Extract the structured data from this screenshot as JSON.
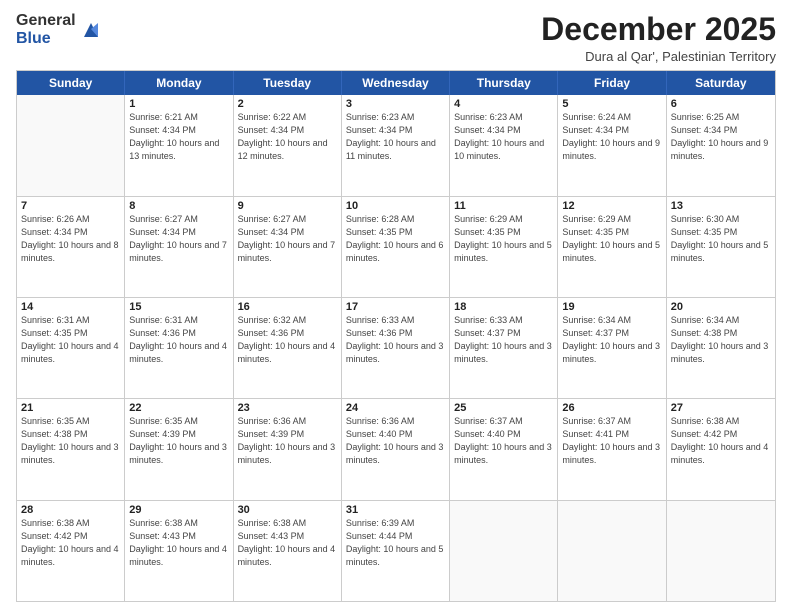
{
  "header": {
    "logo_general": "General",
    "logo_blue": "Blue",
    "month_title": "December 2025",
    "location": "Dura al Qar', Palestinian Territory"
  },
  "days_of_week": [
    "Sunday",
    "Monday",
    "Tuesday",
    "Wednesday",
    "Thursday",
    "Friday",
    "Saturday"
  ],
  "weeks": [
    [
      {
        "day": "",
        "empty": true
      },
      {
        "day": "1",
        "sunrise": "6:21 AM",
        "sunset": "4:34 PM",
        "daylight": "10 hours and 13 minutes."
      },
      {
        "day": "2",
        "sunrise": "6:22 AM",
        "sunset": "4:34 PM",
        "daylight": "10 hours and 12 minutes."
      },
      {
        "day": "3",
        "sunrise": "6:23 AM",
        "sunset": "4:34 PM",
        "daylight": "10 hours and 11 minutes."
      },
      {
        "day": "4",
        "sunrise": "6:23 AM",
        "sunset": "4:34 PM",
        "daylight": "10 hours and 10 minutes."
      },
      {
        "day": "5",
        "sunrise": "6:24 AM",
        "sunset": "4:34 PM",
        "daylight": "10 hours and 9 minutes."
      },
      {
        "day": "6",
        "sunrise": "6:25 AM",
        "sunset": "4:34 PM",
        "daylight": "10 hours and 9 minutes."
      }
    ],
    [
      {
        "day": "7",
        "sunrise": "6:26 AM",
        "sunset": "4:34 PM",
        "daylight": "10 hours and 8 minutes."
      },
      {
        "day": "8",
        "sunrise": "6:27 AM",
        "sunset": "4:34 PM",
        "daylight": "10 hours and 7 minutes."
      },
      {
        "day": "9",
        "sunrise": "6:27 AM",
        "sunset": "4:34 PM",
        "daylight": "10 hours and 7 minutes."
      },
      {
        "day": "10",
        "sunrise": "6:28 AM",
        "sunset": "4:35 PM",
        "daylight": "10 hours and 6 minutes."
      },
      {
        "day": "11",
        "sunrise": "6:29 AM",
        "sunset": "4:35 PM",
        "daylight": "10 hours and 5 minutes."
      },
      {
        "day": "12",
        "sunrise": "6:29 AM",
        "sunset": "4:35 PM",
        "daylight": "10 hours and 5 minutes."
      },
      {
        "day": "13",
        "sunrise": "6:30 AM",
        "sunset": "4:35 PM",
        "daylight": "10 hours and 5 minutes."
      }
    ],
    [
      {
        "day": "14",
        "sunrise": "6:31 AM",
        "sunset": "4:35 PM",
        "daylight": "10 hours and 4 minutes."
      },
      {
        "day": "15",
        "sunrise": "6:31 AM",
        "sunset": "4:36 PM",
        "daylight": "10 hours and 4 minutes."
      },
      {
        "day": "16",
        "sunrise": "6:32 AM",
        "sunset": "4:36 PM",
        "daylight": "10 hours and 4 minutes."
      },
      {
        "day": "17",
        "sunrise": "6:33 AM",
        "sunset": "4:36 PM",
        "daylight": "10 hours and 3 minutes."
      },
      {
        "day": "18",
        "sunrise": "6:33 AM",
        "sunset": "4:37 PM",
        "daylight": "10 hours and 3 minutes."
      },
      {
        "day": "19",
        "sunrise": "6:34 AM",
        "sunset": "4:37 PM",
        "daylight": "10 hours and 3 minutes."
      },
      {
        "day": "20",
        "sunrise": "6:34 AM",
        "sunset": "4:38 PM",
        "daylight": "10 hours and 3 minutes."
      }
    ],
    [
      {
        "day": "21",
        "sunrise": "6:35 AM",
        "sunset": "4:38 PM",
        "daylight": "10 hours and 3 minutes."
      },
      {
        "day": "22",
        "sunrise": "6:35 AM",
        "sunset": "4:39 PM",
        "daylight": "10 hours and 3 minutes."
      },
      {
        "day": "23",
        "sunrise": "6:36 AM",
        "sunset": "4:39 PM",
        "daylight": "10 hours and 3 minutes."
      },
      {
        "day": "24",
        "sunrise": "6:36 AM",
        "sunset": "4:40 PM",
        "daylight": "10 hours and 3 minutes."
      },
      {
        "day": "25",
        "sunrise": "6:37 AM",
        "sunset": "4:40 PM",
        "daylight": "10 hours and 3 minutes."
      },
      {
        "day": "26",
        "sunrise": "6:37 AM",
        "sunset": "4:41 PM",
        "daylight": "10 hours and 3 minutes."
      },
      {
        "day": "27",
        "sunrise": "6:38 AM",
        "sunset": "4:42 PM",
        "daylight": "10 hours and 4 minutes."
      }
    ],
    [
      {
        "day": "28",
        "sunrise": "6:38 AM",
        "sunset": "4:42 PM",
        "daylight": "10 hours and 4 minutes."
      },
      {
        "day": "29",
        "sunrise": "6:38 AM",
        "sunset": "4:43 PM",
        "daylight": "10 hours and 4 minutes."
      },
      {
        "day": "30",
        "sunrise": "6:38 AM",
        "sunset": "4:43 PM",
        "daylight": "10 hours and 4 minutes."
      },
      {
        "day": "31",
        "sunrise": "6:39 AM",
        "sunset": "4:44 PM",
        "daylight": "10 hours and 5 minutes."
      },
      {
        "day": "",
        "empty": true
      },
      {
        "day": "",
        "empty": true
      },
      {
        "day": "",
        "empty": true
      }
    ]
  ]
}
